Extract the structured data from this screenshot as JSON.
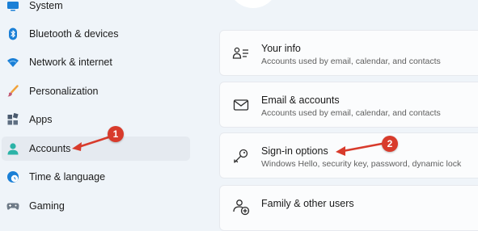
{
  "sidebar": {
    "items": [
      {
        "label": "System",
        "icon": "system-icon",
        "selected": false
      },
      {
        "label": "Bluetooth & devices",
        "icon": "bluetooth-icon",
        "selected": false
      },
      {
        "label": "Network & internet",
        "icon": "wifi-icon",
        "selected": false
      },
      {
        "label": "Personalization",
        "icon": "paintbrush-icon",
        "selected": false
      },
      {
        "label": "Apps",
        "icon": "apps-icon",
        "selected": false
      },
      {
        "label": "Accounts",
        "icon": "person-icon",
        "selected": true
      },
      {
        "label": "Time & language",
        "icon": "globe-clock-icon",
        "selected": false
      },
      {
        "label": "Gaming",
        "icon": "gamepad-icon",
        "selected": false
      }
    ]
  },
  "main": {
    "cards": [
      {
        "title": "Your info",
        "subtitle": "Accounts used by email, calendar, and contacts",
        "icon": "contact-card-icon"
      },
      {
        "title": "Email & accounts",
        "subtitle": "Accounts used by email, calendar, and contacts",
        "icon": "mail-icon"
      },
      {
        "title": "Sign-in options",
        "subtitle": "Windows Hello, security key, password, dynamic lock",
        "icon": "key-icon"
      },
      {
        "title": "Family & other users",
        "subtitle": "",
        "icon": "add-people-icon"
      }
    ]
  },
  "annotations": {
    "step1": "1",
    "step2": "2",
    "color": "#d83b2c"
  },
  "colors": {
    "background": "#eff4f9",
    "card": "#fbfcfd",
    "accent": "#0067c0"
  }
}
